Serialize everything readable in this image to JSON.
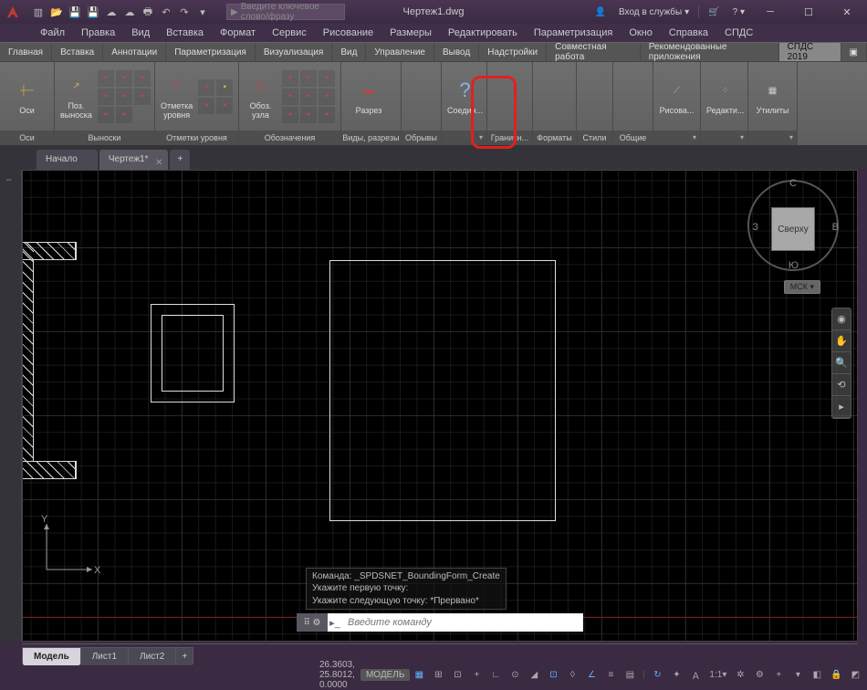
{
  "title": "Чертеж1.dwg",
  "search_placeholder": "Введите ключевое слово/фразу",
  "login_label": "Вход в службы",
  "menu": [
    "Файл",
    "Правка",
    "Вид",
    "Вставка",
    "Формат",
    "Сервис",
    "Рисование",
    "Размеры",
    "Редактировать",
    "Параметризация",
    "Окно",
    "Справка",
    "СПДС"
  ],
  "ribbon_tabs": [
    "Главная",
    "Вставка",
    "Аннотации",
    "Параметризация",
    "Визуализация",
    "Вид",
    "Управление",
    "Вывод",
    "Надстройки",
    "Совместная работа",
    "Рекомендованные приложения",
    "СПДС 2019"
  ],
  "active_ribbon_tab": "СПДС 2019",
  "panels": {
    "axes": {
      "btn": "Оси",
      "title": "Оси"
    },
    "vyn": {
      "btn": "Поз.\nвыноска",
      "title": "Выноски"
    },
    "lvl": {
      "btn": "Отметка\nуровня",
      "title": "Отметки уровня"
    },
    "obz": {
      "btn": "Обоз.\nузла",
      "title": "Обозначения"
    },
    "raz": {
      "btn": "Разрез",
      "title": "Виды, разрезы"
    },
    "obr": {
      "title": "Обрывы"
    },
    "soe": {
      "btn": "Соедин...",
      "title": ""
    },
    "gra": {
      "title": "Граничн..."
    },
    "for": {
      "title": "Форматы"
    },
    "sti": {
      "title": "Стили"
    },
    "obs": {
      "title": "Общие"
    },
    "ris": {
      "btn": "Рисова...",
      "title": ""
    },
    "red": {
      "btn": "Редакти...",
      "title": ""
    },
    "uti": {
      "btn": "Утилиты",
      "title": ""
    }
  },
  "filetabs": [
    {
      "label": "Начало",
      "active": false,
      "close": false
    },
    {
      "label": "Чертеж1*",
      "active": true,
      "close": true
    }
  ],
  "viewcube": {
    "face": "Сверху",
    "n": "С",
    "s": "Ю",
    "e": "В",
    "w": "З",
    "wcs": "МСК"
  },
  "ucs": {
    "x": "X",
    "y": "Y"
  },
  "cmd_history": [
    "Команда: _SPDSNET_BoundingForm_Create",
    "Укажите первую точку:",
    "Укажите следующую точку: *Прервано*"
  ],
  "cmd_placeholder": "Введите команду",
  "bottom_tabs": [
    "Модель",
    "Лист1",
    "Лист2"
  ],
  "active_bottom_tab": "Модель",
  "status": {
    "coords": "26.3603, 25.8012, 0.0000",
    "space": "МОДЕЛЬ",
    "scale": "1:1"
  }
}
